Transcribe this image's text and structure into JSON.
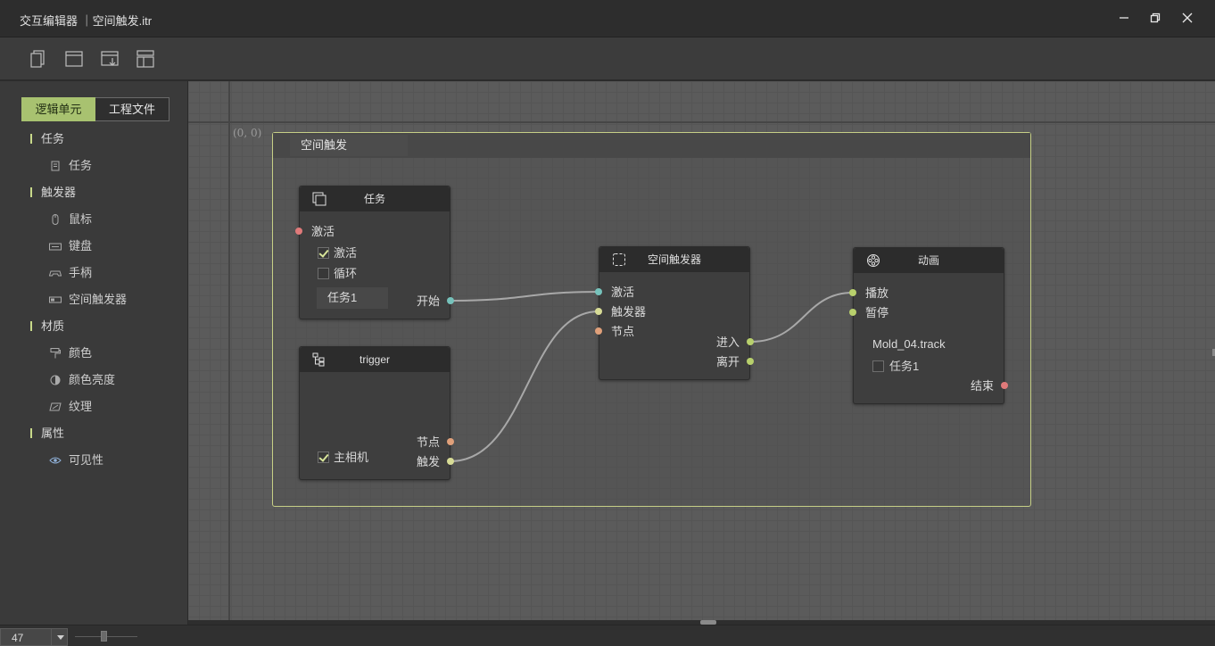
{
  "window": {
    "title": "交互编辑器 ｜空间触发.itr"
  },
  "icons": {
    "toolbar": [
      "new-document-icon",
      "window-icon",
      "import-icon",
      "layout-icon"
    ],
    "window_controls": [
      "minimize-icon",
      "restore-icon",
      "close-icon"
    ]
  },
  "sidebar": {
    "tabs": [
      {
        "label": "逻辑单元",
        "active": true
      },
      {
        "label": "工程文件",
        "active": false
      }
    ],
    "categories": [
      {
        "label": "任务",
        "items": [
          {
            "label": "任务",
            "icon": "clipboard-icon"
          }
        ]
      },
      {
        "label": "触发器",
        "items": [
          {
            "label": "鼠标",
            "icon": "mouse-icon"
          },
          {
            "label": "键盘",
            "icon": "keyboard-icon"
          },
          {
            "label": "手柄",
            "icon": "gamepad-icon"
          },
          {
            "label": "空间触发器",
            "icon": "space-trigger-icon"
          }
        ]
      },
      {
        "label": "材质",
        "items": [
          {
            "label": "颜色",
            "icon": "paint-roller-icon"
          },
          {
            "label": "颜色亮度",
            "icon": "contrast-icon"
          },
          {
            "label": "纹理",
            "icon": "texture-icon"
          }
        ]
      },
      {
        "label": "属性",
        "items": [
          {
            "label": "可见性",
            "icon": "eye-icon"
          }
        ]
      }
    ]
  },
  "canvas": {
    "origin_label": "(0, 0)",
    "group": {
      "title": "空间触发"
    },
    "nodes": {
      "task": {
        "title": "任务",
        "input_activate": "激活",
        "check_activate": {
          "label": "激活",
          "checked": true
        },
        "check_loop": {
          "label": "循环",
          "checked": false
        },
        "name_field": "任务1",
        "output_start": "开始"
      },
      "trigger": {
        "title": "trigger",
        "output_node": "节点",
        "output_trigger": "触发",
        "check_camera": {
          "label": "主相机",
          "checked": true
        }
      },
      "space_trigger": {
        "title": "空间触发器",
        "input_activate": "激活",
        "input_trigger": "触发器",
        "input_node": "节点",
        "output_enter": "进入",
        "output_leave": "离开"
      },
      "animation": {
        "title": "动画",
        "input_play": "播放",
        "input_pause": "暂停",
        "track": "Mold_04.track",
        "check_task": {
          "label": "任务1",
          "checked": false
        },
        "output_end": "结束"
      }
    }
  },
  "colors": {
    "accent": "#a8c270",
    "group_border": "#c6cf86",
    "port_teal": "#76c2bb",
    "port_yellow": "#d8dc96",
    "port_orange": "#e0a07a",
    "port_red": "#e07a7a",
    "port_green": "#b8d06c",
    "wire": "#a8a8a8"
  },
  "statusbar": {
    "zoom": "47"
  }
}
